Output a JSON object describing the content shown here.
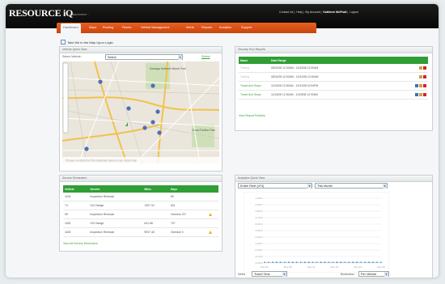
{
  "brand": {
    "name": "RESOURCE iQ",
    "tagline": "CONNECTIONS BY ..."
  },
  "top_links": [
    "Contact Us",
    "Help",
    "My Account",
    "Kathleen McPhail",
    "Logout"
  ],
  "tabs": [
    "Dashboard",
    "Maps",
    "Routing",
    "Places",
    "Vehicle Management",
    "Alerts",
    "Reports",
    "Analytics",
    "Support"
  ],
  "checkbox_label": "Take Me to the Map Upon Login",
  "vehicle_quick_view": {
    "title": "Vehicle Quick View",
    "select_label": "Select Vehicle:",
    "select_value": "Select",
    "select_button": "Select",
    "map_hint": "Choose a vehicle from the dropdown above to see on the map",
    "map_labels": [
      "Saratoga National Historic Park",
      "Chodo Pavilion Park"
    ]
  },
  "security_run_reports": {
    "title": "Security Run Reports",
    "columns": [
      "Name",
      "Date Range"
    ],
    "rows": [
      {
        "name": "Testing",
        "range": "08/31/08 12:00AM - 11/30/08 12:00AM",
        "muted": true
      },
      {
        "name": "Testing",
        "range": "08/31/08 12:00AM - 12/31/08 12:00AM",
        "muted": true
      },
      {
        "name": "Travel And Stops",
        "range": "11/24/08 12:00AM - 12/31/08 10:54PM",
        "muted": false
      },
      {
        "name": "Travel And Stops",
        "range": "11/24/08 12:00AM - 11/25/08 12:00AM",
        "muted": false
      }
    ],
    "view_link": "View Report Portfolio"
  },
  "service_reminders": {
    "title": "Service Reminders",
    "columns": [
      "Vehicle",
      "Service",
      "Miles",
      "Days"
    ],
    "rows": [
      {
        "vehicle": "1105",
        "service": "Inspection Renewal",
        "miles": "",
        "days": "59",
        "warn": false
      },
      {
        "vehicle": "74",
        "service": "Oil Change",
        "miles": "1307.04",
        "days": "601",
        "warn": false
      },
      {
        "vehicle": "59",
        "service": "Inspection Renewal",
        "miles": "",
        "days": "Overdue 217",
        "warn": true
      },
      {
        "vehicle": "1183",
        "service": "Oil Change",
        "miles": "641.68",
        "days": "797",
        "warn": false
      },
      {
        "vehicle": "1183",
        "service": "Inspection Renewal",
        "miles": "9937.48",
        "days": "Overdue 3",
        "warn": true
      }
    ],
    "view_link": "View All Service Reminders"
  },
  "analytics_quick_view": {
    "title": "Analytics Quick View",
    "select_left": "Entire Fleet (474)",
    "select_right": "This Month",
    "metric_label": "Metric",
    "metric_value": "Travel Time",
    "breakdown_label": "Breakdown",
    "breakdown_value": "Per Vehicle"
  },
  "chart_data": {
    "type": "line",
    "x": [
      "Nov 01",
      "Nov 06",
      "Nov 11",
      "Nov 16",
      "Nov 21",
      "Nov 26"
    ],
    "y_ticks": [
      "1.00 hr",
      "0.90 hr",
      "0.80 hr",
      "0.70 hr",
      "0.60 hr",
      "0.50 hr",
      "0.40 hr",
      "0.30 hr",
      "0.20 hr",
      "0.10 hr",
      "0.00 hr"
    ],
    "ylim": [
      0,
      1
    ],
    "series": [
      {
        "values": [
          0.01,
          0.01,
          0.01,
          0.01,
          0.01,
          0.01,
          0.01,
          0.01,
          0.01,
          0.01,
          0.01,
          0.01,
          0.01,
          0.01,
          0.01,
          0.01,
          0.01,
          0.01,
          0.01,
          0.01,
          0.01,
          0.01,
          0.01,
          0.01,
          0.01,
          0.01,
          0.01,
          0.01,
          0.01,
          0.01
        ],
        "color": "#3a7fc0"
      }
    ],
    "grid": true
  }
}
